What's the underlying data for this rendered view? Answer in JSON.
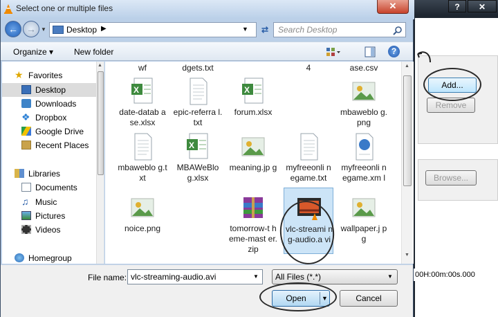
{
  "dialog": {
    "title": "Select one or multiple files",
    "close_glyph": "✕",
    "address": "Desktop",
    "search_placeholder": "Search Desktop",
    "organize_label": "Organize ▾",
    "new_folder_label": "New folder"
  },
  "nav": {
    "favorites_label": "Favorites",
    "favorites": [
      "Desktop",
      "Downloads",
      "Dropbox",
      "Google Drive",
      "Recent Places"
    ],
    "libraries_label": "Libraries",
    "libraries": [
      "Documents",
      "Music",
      "Pictures",
      "Videos"
    ],
    "homegroup_label": "Homegroup"
  },
  "top_partial_labels": [
    "wf",
    "dgets.txt",
    "4",
    "ase.csv"
  ],
  "files": [
    {
      "label": "date-datab ase.xlsx",
      "icon": "excel-icon"
    },
    {
      "label": "epic-referra l.txt",
      "icon": "text-file-icon"
    },
    {
      "label": "forum.xlsx",
      "icon": "excel-icon"
    },
    {
      "label": "",
      "icon": "blank-icon"
    },
    {
      "label": "mbaweblo g.png",
      "icon": "image-icon"
    },
    {
      "label": "mbaweblo g.txt",
      "icon": "text-file-icon"
    },
    {
      "label": "MBAWeBlo g.xlsx",
      "icon": "excel-icon"
    },
    {
      "label": "meaning.jp g",
      "icon": "image-icon"
    },
    {
      "label": "myfreeonli negame.txt",
      "icon": "text-file-icon"
    },
    {
      "label": "myfreeonli negame.xm l",
      "icon": "xml-icon"
    },
    {
      "label": "noice.png",
      "icon": "image-icon"
    },
    {
      "label": "",
      "icon": "blank-icon"
    },
    {
      "label": "tomorrow-t heme-mast er.zip",
      "icon": "zip-icon"
    },
    {
      "label": "vlc-streami ng-audio.a vi",
      "icon": "video-icon"
    },
    {
      "label": "wallpaper.j pg",
      "icon": "image-icon"
    }
  ],
  "footer": {
    "file_name_label": "File name:",
    "file_name_value": "vlc-streaming-audio.avi",
    "filter_value": "All Files (*.*)",
    "open_label": "Open",
    "cancel_label": "Cancel"
  },
  "background_app": {
    "help_glyph": "?",
    "close_glyph": "✕",
    "add_label": "Add...",
    "remove_label": "Remove",
    "browse_label": "Browse...",
    "time_value": "00H:00m:00s.000"
  }
}
